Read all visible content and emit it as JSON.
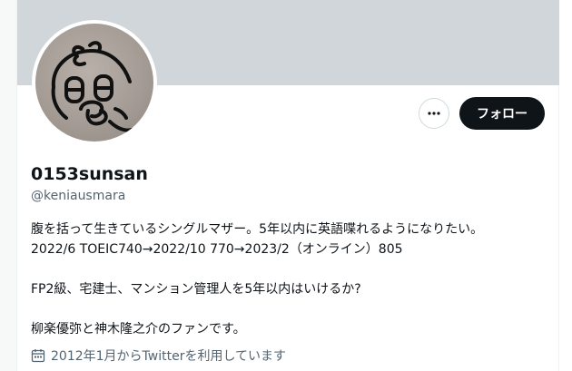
{
  "profile": {
    "display_name": "0153sunsan",
    "handle": "@keniausmara",
    "bio_lines": [
      "腹を括って生きているシングルマザー。5年以内に英語喋れるようになりたい。",
      "2022/6 TOEIC740→2022/10 770→2023/2（オンライン）805",
      "",
      "FP2級、宅建士、マンション管理人を5年以内はいけるか?",
      "",
      "柳楽優弥と神木隆之介のファンです。"
    ],
    "joined_text": "2012年1月からTwitterを利用しています"
  },
  "actions": {
    "follow_label": "フォロー",
    "more_icon": "more-horizontal-icon"
  },
  "icons": {
    "joined": "calendar-icon"
  },
  "colors": {
    "banner": "#d0d6da",
    "follow_bg": "#0f1419",
    "secondary_text": "#536471"
  }
}
